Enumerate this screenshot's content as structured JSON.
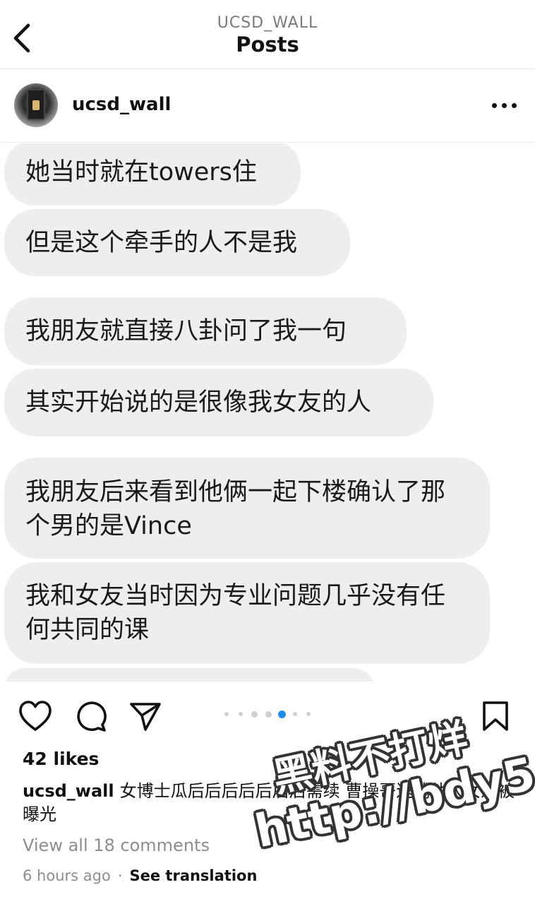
{
  "header": {
    "handle": "UCSD_WALL",
    "title": "Posts"
  },
  "post": {
    "username": "ucsd_wall",
    "messages": [
      "她当时就在towers住",
      "但是这个牵手的人不是我",
      "我朋友就直接八卦问了我一句",
      "其实开始说的是很像我女友的人",
      "我朋友后来看到他俩一起下楼确认了那个男的是Vince",
      "我和女友当时因为专业问题几乎没有任何共同的课"
    ],
    "carousel": {
      "count": 6,
      "active_index": 3
    },
    "likes": "42 likes",
    "caption_user": "ucsd_wall",
    "caption_text": "女博士瓜后后后后后后后需续 曹操哥逮捕他人女友被曝光",
    "view_comments": "View all 18 comments",
    "time": "6 hours ago",
    "separator": "·",
    "see_translation": "See translation"
  },
  "watermark": {
    "line1": "黑料不打烊",
    "line2": "http://bdy5.co"
  },
  "icons": {
    "back": "chevron-left-icon",
    "more": "more-horizontal-icon",
    "like": "heart-icon",
    "comment": "comment-icon",
    "share": "send-icon",
    "save": "bookmark-icon"
  },
  "colors": {
    "bubble": "#eeeeee",
    "carousel_active": "#1c8ef0",
    "muted_text": "#8e8e8e"
  }
}
